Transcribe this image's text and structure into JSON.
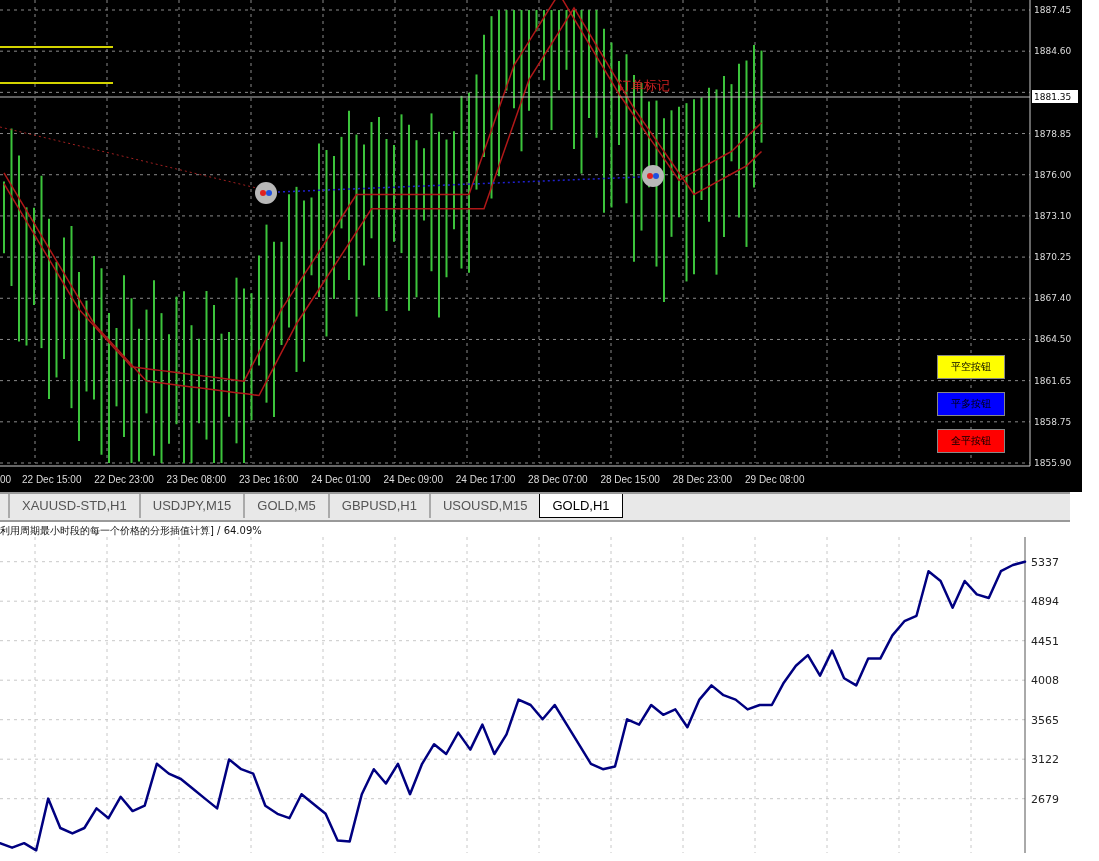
{
  "price_chart": {
    "price_axis": [
      {
        "label": "1887.45",
        "kind": "tick"
      },
      {
        "label": "1884.60",
        "kind": "tick"
      },
      {
        "label": "1881.35",
        "kind": "current"
      },
      {
        "label": "1878.85",
        "kind": "tick"
      },
      {
        "label": "1876.00",
        "kind": "tick"
      },
      {
        "label": "1873.10",
        "kind": "tick"
      },
      {
        "label": "1870.25",
        "kind": "tick"
      },
      {
        "label": "1867.40",
        "kind": "tick"
      },
      {
        "label": "1864.50",
        "kind": "tick"
      },
      {
        "label": "1861.65",
        "kind": "tick"
      },
      {
        "label": "1858.75",
        "kind": "tick"
      },
      {
        "label": "1855.90",
        "kind": "tick"
      }
    ],
    "time_axis": [
      "00",
      "22 Dec 15:00",
      "22 Dec 23:00",
      "23 Dec 08:00",
      "23 Dec 16:00",
      "24 Dec 01:00",
      "24 Dec 09:00",
      "24 Dec 17:00",
      "28 Dec 07:00",
      "28 Dec 15:00",
      "28 Dec 23:00",
      "29 Dec 08:00"
    ],
    "order_label": "订单标记",
    "buttons": [
      {
        "label": "平空按钮",
        "color": "#ffff00"
      },
      {
        "label": "平多按钮",
        "color": "#0000ff"
      },
      {
        "label": "全平按钮",
        "color": "#ff0000"
      }
    ]
  },
  "tabs": [
    {
      "label": "XAUUSD-STD,H1",
      "selected": false
    },
    {
      "label": "USDJPY,M15",
      "selected": false
    },
    {
      "label": "GOLD,M5",
      "selected": false
    },
    {
      "label": "GBPUSD,H1",
      "selected": false
    },
    {
      "label": "USOUSD,M15",
      "selected": false
    },
    {
      "label": "GOLD,H1",
      "selected": true
    }
  ],
  "equity_chart": {
    "title": "利用周期最小时段的每一个价格的分形插值计算] / 64.09%",
    "chart_data": {
      "type": "line",
      "grid": true,
      "ylim": [
        2070,
        5614
      ],
      "yticks": [
        2679,
        3122,
        3565,
        4008,
        4451,
        4894,
        5337
      ],
      "series": [
        {
          "color": "#000080",
          "values": [
            2180,
            2130,
            2180,
            2100,
            2680,
            2350,
            2290,
            2350,
            2570,
            2460,
            2700,
            2540,
            2600,
            3070,
            2960,
            2900,
            2790,
            2680,
            2570,
            3120,
            3010,
            2960,
            2600,
            2510,
            2460,
            2730,
            2620,
            2510,
            2210,
            2200,
            2730,
            3010,
            2850,
            3070,
            2730,
            3070,
            3290,
            3180,
            3420,
            3230,
            3510,
            3180,
            3400,
            3790,
            3730,
            3570,
            3730,
            3510,
            3290,
            3070,
            3010,
            3040,
            3570,
            3510,
            3730,
            3620,
            3680,
            3480,
            3790,
            3950,
            3840,
            3790,
            3680,
            3730,
            3730,
            3980,
            4170,
            4290,
            4060,
            4340,
            4030,
            3950,
            4250,
            4250,
            4510,
            4670,
            4730,
            5230,
            5120,
            4820,
            5120,
            4970,
            4930,
            5230,
            5300,
            5337
          ]
        }
      ]
    }
  }
}
